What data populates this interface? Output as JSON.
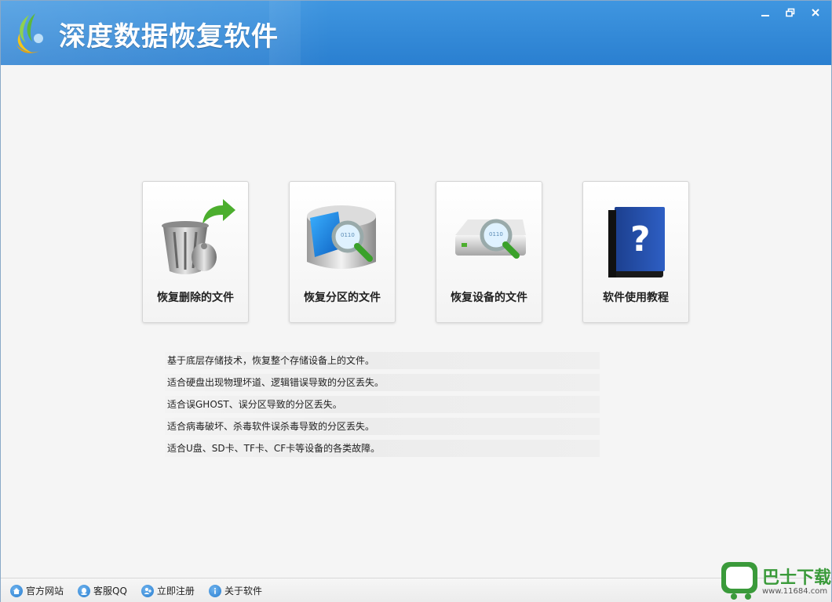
{
  "window": {
    "title": "深度数据恢复软件",
    "controls": {
      "minimize": "minimize-icon",
      "restore": "restore-icon",
      "close": "close-icon"
    }
  },
  "tiles": [
    {
      "label": "恢复删除的文件",
      "icon": "recycle-bin-icon"
    },
    {
      "label": "恢复分区的文件",
      "icon": "partition-search-icon"
    },
    {
      "label": "恢复设备的文件",
      "icon": "device-search-icon"
    },
    {
      "label": "软件使用教程",
      "icon": "help-book-icon"
    }
  ],
  "descriptions": [
    "基于底层存储技术，恢复整个存储设备上的文件。",
    "适合硬盘出现物理坏道、逻辑错误导致的分区丢失。",
    "适合误GHOST、误分区导致的分区丢失。",
    "适合病毒破坏、杀毒软件误杀毒导致的分区丢失。",
    "适合U盘、SD卡、TF卡、CF卡等设备的各类故障。"
  ],
  "footer": {
    "links": [
      {
        "label": "官方网站",
        "icon": "home-icon"
      },
      {
        "label": "客服QQ",
        "icon": "qq-icon"
      },
      {
        "label": "立即注册",
        "icon": "register-icon"
      },
      {
        "label": "关于软件",
        "icon": "info-icon"
      }
    ]
  },
  "watermark": {
    "text": "巴士下载",
    "url": "www.11684.com"
  },
  "colors": {
    "titlebar": "#2a7fd0",
    "accent_green": "#3a9a3a"
  }
}
